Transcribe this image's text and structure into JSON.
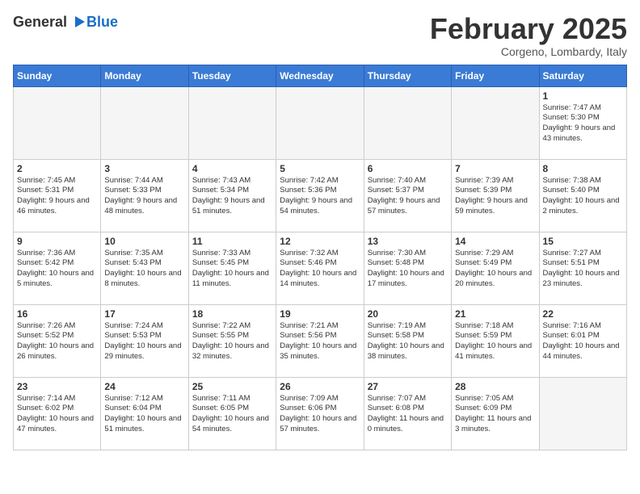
{
  "header": {
    "logo": {
      "general": "General",
      "blue": "Blue"
    },
    "title": "February 2025",
    "location": "Corgeno, Lombardy, Italy"
  },
  "weekdays": [
    "Sunday",
    "Monday",
    "Tuesday",
    "Wednesday",
    "Thursday",
    "Friday",
    "Saturday"
  ],
  "weeks": [
    [
      {
        "day": "",
        "info": ""
      },
      {
        "day": "",
        "info": ""
      },
      {
        "day": "",
        "info": ""
      },
      {
        "day": "",
        "info": ""
      },
      {
        "day": "",
        "info": ""
      },
      {
        "day": "",
        "info": ""
      },
      {
        "day": "1",
        "info": "Sunrise: 7:47 AM\nSunset: 5:30 PM\nDaylight: 9 hours and 43 minutes."
      }
    ],
    [
      {
        "day": "2",
        "info": "Sunrise: 7:45 AM\nSunset: 5:31 PM\nDaylight: 9 hours and 46 minutes."
      },
      {
        "day": "3",
        "info": "Sunrise: 7:44 AM\nSunset: 5:33 PM\nDaylight: 9 hours and 48 minutes."
      },
      {
        "day": "4",
        "info": "Sunrise: 7:43 AM\nSunset: 5:34 PM\nDaylight: 9 hours and 51 minutes."
      },
      {
        "day": "5",
        "info": "Sunrise: 7:42 AM\nSunset: 5:36 PM\nDaylight: 9 hours and 54 minutes."
      },
      {
        "day": "6",
        "info": "Sunrise: 7:40 AM\nSunset: 5:37 PM\nDaylight: 9 hours and 57 minutes."
      },
      {
        "day": "7",
        "info": "Sunrise: 7:39 AM\nSunset: 5:39 PM\nDaylight: 9 hours and 59 minutes."
      },
      {
        "day": "8",
        "info": "Sunrise: 7:38 AM\nSunset: 5:40 PM\nDaylight: 10 hours and 2 minutes."
      }
    ],
    [
      {
        "day": "9",
        "info": "Sunrise: 7:36 AM\nSunset: 5:42 PM\nDaylight: 10 hours and 5 minutes."
      },
      {
        "day": "10",
        "info": "Sunrise: 7:35 AM\nSunset: 5:43 PM\nDaylight: 10 hours and 8 minutes."
      },
      {
        "day": "11",
        "info": "Sunrise: 7:33 AM\nSunset: 5:45 PM\nDaylight: 10 hours and 11 minutes."
      },
      {
        "day": "12",
        "info": "Sunrise: 7:32 AM\nSunset: 5:46 PM\nDaylight: 10 hours and 14 minutes."
      },
      {
        "day": "13",
        "info": "Sunrise: 7:30 AM\nSunset: 5:48 PM\nDaylight: 10 hours and 17 minutes."
      },
      {
        "day": "14",
        "info": "Sunrise: 7:29 AM\nSunset: 5:49 PM\nDaylight: 10 hours and 20 minutes."
      },
      {
        "day": "15",
        "info": "Sunrise: 7:27 AM\nSunset: 5:51 PM\nDaylight: 10 hours and 23 minutes."
      }
    ],
    [
      {
        "day": "16",
        "info": "Sunrise: 7:26 AM\nSunset: 5:52 PM\nDaylight: 10 hours and 26 minutes."
      },
      {
        "day": "17",
        "info": "Sunrise: 7:24 AM\nSunset: 5:53 PM\nDaylight: 10 hours and 29 minutes."
      },
      {
        "day": "18",
        "info": "Sunrise: 7:22 AM\nSunset: 5:55 PM\nDaylight: 10 hours and 32 minutes."
      },
      {
        "day": "19",
        "info": "Sunrise: 7:21 AM\nSunset: 5:56 PM\nDaylight: 10 hours and 35 minutes."
      },
      {
        "day": "20",
        "info": "Sunrise: 7:19 AM\nSunset: 5:58 PM\nDaylight: 10 hours and 38 minutes."
      },
      {
        "day": "21",
        "info": "Sunrise: 7:18 AM\nSunset: 5:59 PM\nDaylight: 10 hours and 41 minutes."
      },
      {
        "day": "22",
        "info": "Sunrise: 7:16 AM\nSunset: 6:01 PM\nDaylight: 10 hours and 44 minutes."
      }
    ],
    [
      {
        "day": "23",
        "info": "Sunrise: 7:14 AM\nSunset: 6:02 PM\nDaylight: 10 hours and 47 minutes."
      },
      {
        "day": "24",
        "info": "Sunrise: 7:12 AM\nSunset: 6:04 PM\nDaylight: 10 hours and 51 minutes."
      },
      {
        "day": "25",
        "info": "Sunrise: 7:11 AM\nSunset: 6:05 PM\nDaylight: 10 hours and 54 minutes."
      },
      {
        "day": "26",
        "info": "Sunrise: 7:09 AM\nSunset: 6:06 PM\nDaylight: 10 hours and 57 minutes."
      },
      {
        "day": "27",
        "info": "Sunrise: 7:07 AM\nSunset: 6:08 PM\nDaylight: 11 hours and 0 minutes."
      },
      {
        "day": "28",
        "info": "Sunrise: 7:05 AM\nSunset: 6:09 PM\nDaylight: 11 hours and 3 minutes."
      },
      {
        "day": "",
        "info": ""
      }
    ]
  ]
}
